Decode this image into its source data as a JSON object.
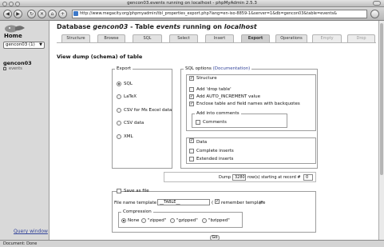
{
  "window": {
    "title": "gencon03.events running on localhost - phpMyAdmin 2.5.3",
    "url": "http://www.megacity.org/phpmyadmin/tbl_properties_export.php?lang=en-iso-8859-1&server=1&db=gencon03&table=events&"
  },
  "sidebar": {
    "home_label": "Home",
    "db_select_value": "gencon03 (1)",
    "db_name": "gencon03",
    "table_name": "events",
    "query_window_label": "Query window"
  },
  "header": {
    "prefix": "Database ",
    "db": "gencon03",
    "middle": " - Table ",
    "table": "events",
    "suffix": " running on ",
    "host": "localhost"
  },
  "tabs": [
    {
      "label": "Structure"
    },
    {
      "label": "Browse"
    },
    {
      "label": "SQL"
    },
    {
      "label": "Select"
    },
    {
      "label": "Insert"
    },
    {
      "label": "Export"
    },
    {
      "label": "Operations"
    },
    {
      "label": "Empty"
    },
    {
      "label": "Drop"
    }
  ],
  "section_title": "View dump (schema) of table",
  "export": {
    "legend": "Export",
    "options": [
      {
        "label": "SQL",
        "selected": true
      },
      {
        "label": "LaTeX",
        "selected": false
      },
      {
        "label": "CSV for Ms Excel data",
        "selected": false
      },
      {
        "label": "CSV data",
        "selected": false
      },
      {
        "label": "XML",
        "selected": false
      }
    ]
  },
  "sql_options": {
    "legend": "SQL options",
    "doc_link": "(Documentation)",
    "structure_label": "Structure",
    "structure_checked": true,
    "structure_items": [
      {
        "label": "Add 'drop table'",
        "checked": false
      },
      {
        "label": "Add AUTO_INCREMENT value",
        "checked": true
      },
      {
        "label": "Enclose table and field names with backquotes",
        "checked": true
      }
    ],
    "comments_legend": "Add into comments",
    "comments_label": "Comments",
    "data_label": "Data",
    "data_checked": true,
    "data_items": [
      {
        "label": "Complete inserts",
        "checked": false
      },
      {
        "label": "Extended inserts",
        "checked": false
      }
    ]
  },
  "dump": {
    "prefix": "Dump",
    "rows_value": "3280",
    "middle": "row(s) starting at record #",
    "start_value": "0"
  },
  "save": {
    "save_label": "Save as file",
    "template_label": "File name template :",
    "template_value": "__TABLE__",
    "paren_open": "(",
    "remember_label": "remember template",
    "paren_close": ")*",
    "compression_legend": "Compression",
    "compression": [
      {
        "label": "None",
        "selected": true
      },
      {
        "label": "\"zipped\"",
        "selected": false
      },
      {
        "label": "\"gzipped\"",
        "selected": false
      },
      {
        "label": "\"bzipped\"",
        "selected": false
      }
    ]
  },
  "go_label": "Go",
  "status": "Document: Done",
  "colors": {
    "link": "#33449a",
    "chrome": "#c8c8c8",
    "sidebar": "#d9d9d9"
  }
}
